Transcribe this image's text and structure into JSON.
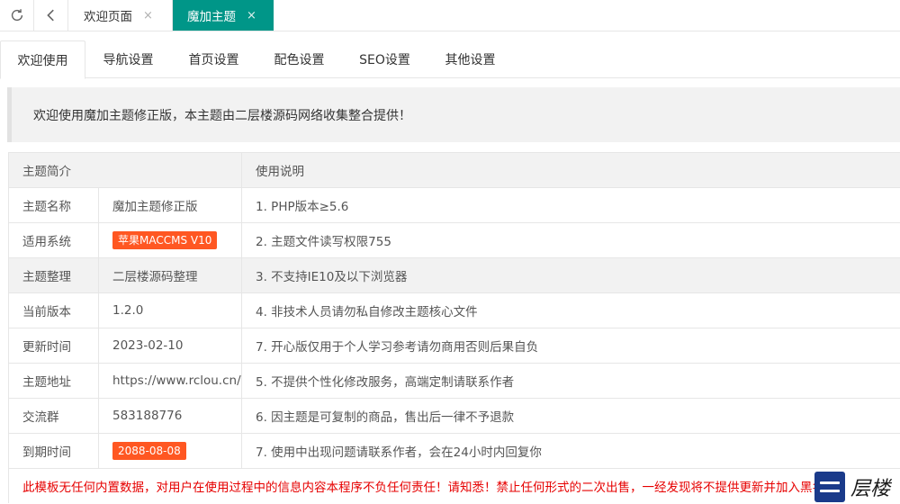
{
  "window_tabs": [
    {
      "label": "欢迎页面",
      "active": false,
      "close": "×"
    },
    {
      "label": "魔加主题",
      "active": true,
      "close": "×"
    }
  ],
  "toolbar": {
    "refresh_icon": "refresh-icon",
    "back_icon": "chevron-left-icon"
  },
  "settings_tabs": [
    "欢迎使用",
    "导航设置",
    "首页设置",
    "配色设置",
    "SEO设置",
    "其他设置"
  ],
  "notice": "欢迎使用魔加主题修正版，本主题由二层楼源码网络收集整合提供！",
  "table": {
    "headers": [
      "主题简介",
      "使用说明"
    ],
    "rows": [
      {
        "key": "主题名称",
        "value": "魔加主题修正版",
        "badge": false,
        "note": "1. PHP版本≥5.6"
      },
      {
        "key": "适用系统",
        "value": "苹果MACCMS V10",
        "badge": true,
        "note": "2. 主题文件读写权限755"
      },
      {
        "key": "主题整理",
        "value": "二层楼源码整理",
        "badge": false,
        "note": "3. 不支持IE10及以下浏览器"
      },
      {
        "key": "当前版本",
        "value": "1.2.0",
        "badge": false,
        "note": "4. 非技术人员请勿私自修改主题核心文件"
      },
      {
        "key": "更新时间",
        "value": "2023-02-10",
        "badge": false,
        "note": "7. 开心版仅用于个人学习参考请勿商用否则后果自负"
      },
      {
        "key": "主题地址",
        "value": "https://www.rclou.cn/",
        "badge": false,
        "note": "5. 不提供个性化修改服务，高端定制请联系作者"
      },
      {
        "key": "交流群",
        "value": "583188776",
        "badge": false,
        "note": "6. 因主题是可复制的商品，售出后一律不予退款"
      },
      {
        "key": "到期时间",
        "value": "2088-08-08",
        "badge": true,
        "note": "7. 使用中出现问题请联系作者，会在24小时内回复你"
      }
    ],
    "warning": "此模板无任何内置数据，对用户在使用过程中的信息内容本程序不负任何责任！请知悉！禁止任何形式的二次出售，一经发现将不提供更新并加入黑名单"
  },
  "colors": {
    "accent": "#009688",
    "badge": "#ff5722",
    "warning": "#e60000"
  },
  "logo_text": "层楼"
}
